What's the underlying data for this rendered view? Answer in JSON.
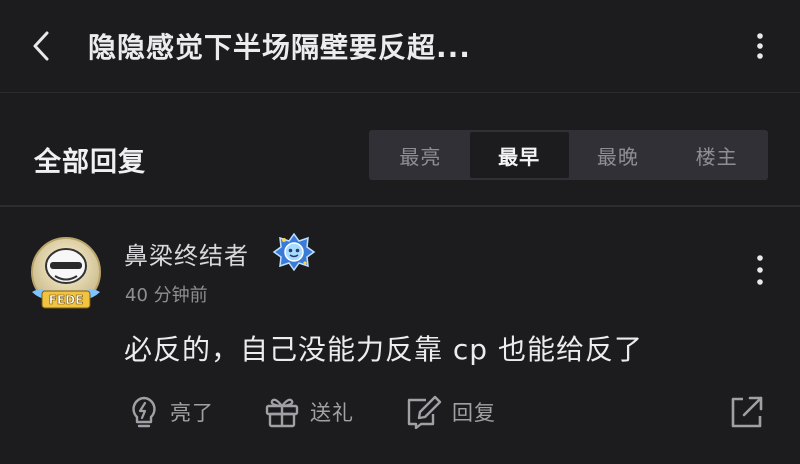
{
  "header": {
    "title": "隐隐感觉下半场隔壁要反超...",
    "back_icon": "chevron-left-icon",
    "more_icon": "vertical-dots-icon"
  },
  "replies": {
    "section_title": "全部回复",
    "sort_tabs": [
      {
        "label": "最亮",
        "active": false
      },
      {
        "label": "最早",
        "active": true
      },
      {
        "label": "最晚",
        "active": false
      },
      {
        "label": "楼主",
        "active": false
      }
    ]
  },
  "comment": {
    "username": "鼻梁终结者",
    "avatar_text": "FEDE",
    "time": "40 分钟前",
    "text": "必反的，自己没能力反靠 cp 也能给反了",
    "actions": {
      "like_label": "亮了",
      "gift_label": "送礼",
      "reply_label": "回复"
    }
  },
  "colors": {
    "background": "#1c1c1e",
    "tab_bar": "#303036",
    "text_primary": "#ececee",
    "text_secondary": "#8e8e93"
  }
}
